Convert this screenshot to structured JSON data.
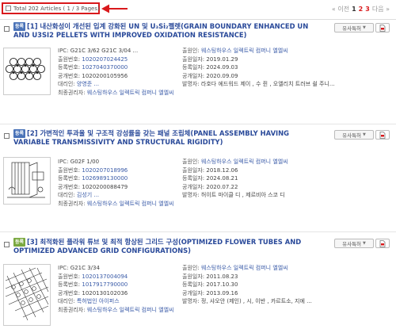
{
  "header": {
    "total_label": "Total 202 Articles ( 1 / 3 Pages)",
    "prev_label": "« 이전",
    "pages": [
      "1",
      "2",
      "3"
    ],
    "next_label": "다음 »"
  },
  "common": {
    "similar_label": "유사특허",
    "colors": {
      "accent_red": "#d9191c",
      "title_blue": "#2a4a9a",
      "badge_registered": "#4a73b8",
      "badge_published": "#7aa840"
    }
  },
  "results": [
    {
      "badge": "등록",
      "number": "[1]",
      "title": "내산화성이 개선된 입계 강화된 UN 및 U₃Si₂펠렛(GRAIN BOUNDARY ENHANCED UN AND U3SI2 PELLETS WITH IMPROVED OXIDATION RESISTANCE)",
      "ipc_label": "IPC:",
      "ipc": "G21C 3/62   G21C 3/04 ...",
      "applicant_label": "출원인:",
      "applicant": "웨스팅하우스 일렉트릭 컴퍼니 엘엘씨",
      "app_no_label": "출원번호:",
      "app_no": "1020207024425",
      "app_date_label": "출원일자:",
      "app_date": "2019.01.29",
      "reg_no_label": "등록번호:",
      "reg_no": "1027040370000",
      "reg_date_label": "등록일자:",
      "reg_date": "2024.09.03",
      "pub_no_label": "공개번호:",
      "pub_no": "1020200105956",
      "pub_date_label": "공개일자:",
      "pub_date": "2020.09.09",
      "agent_label": "대리인:",
      "agent": "양영준 ...",
      "inventor_label": "발명자:",
      "inventor": "라호다 에드워드 제이 , 수 쥔 , 오엘리치 트러브 쉴 주니...",
      "holder_label": "최종권리자:",
      "holder": "웨스팅하우스 일렉트릭 컴퍼니 엘엘씨"
    },
    {
      "badge": "등록",
      "number": "[2]",
      "title": "가변적인 투과율 및 구조적 강성률을 갖는 패널 조립체(PANEL ASSEMBLY HAVING VARIABLE TRANSMISSIVITY AND STRUCTURAL RIGIDITY)",
      "ipc_label": "IPC:",
      "ipc": "G02F 1/00",
      "applicant_label": "출원인:",
      "applicant": "웨스팅하우스 일렉트릭 컴퍼니 엘엘씨",
      "app_no_label": "출원번호:",
      "app_no": "1020207018996",
      "app_date_label": "출원일자:",
      "app_date": "2018.12.06",
      "reg_no_label": "등록번호:",
      "reg_no": "1026989130000",
      "reg_date_label": "등록일자:",
      "reg_date": "2024.08.21",
      "pub_no_label": "공개번호:",
      "pub_no": "1020200088479",
      "pub_date_label": "공개일자:",
      "pub_date": "2020.07.22",
      "agent_label": "대리인:",
      "agent": "김성기 ...",
      "inventor_label": "발명자:",
      "inventor": "허이트 마이클 디 , 제르비아 스코 디",
      "holder_label": "최종권리자:",
      "holder": "웨스팅하우스 일렉트릭 컴퍼니 엘엘씨"
    },
    {
      "badge": "등록",
      "number": "[3]",
      "title": "최적화된 플라워 튜브 및 최적 항상된 그리드 구성(OPTIMIZED FLOWER TUBES AND OPTIMIZED ADVANCED GRID CONFIGURATIONS)",
      "ipc_label": "IPC:",
      "ipc": "G21C 3/34",
      "applicant_label": "출원인:",
      "applicant": "웨스팅하우스 일렉트릭 컴퍼니 엘엘씨",
      "app_no_label": "출원번호:",
      "app_no": "1020137004094",
      "app_date_label": "출원일자:",
      "app_date": "2011.08.23",
      "reg_no_label": "등록번호:",
      "reg_no": "1017917790000",
      "reg_date_label": "등록일자:",
      "reg_date": "2017.10.30",
      "pub_no_label": "공개번호:",
      "pub_no": "1020130102036",
      "pub_date_label": "공개일자:",
      "pub_date": "2013.09.16",
      "agent_label": "대리인:",
      "agent": "특허법인 아이퍼스",
      "inventor_label": "발명자:",
      "inventor": "정, 샤오안 (제인) , 시, 이반 , 카르트소, 지에 ...",
      "holder_label": "최종권리자:",
      "holder": "웨스팅하우스 일렉트릭 컴퍼니 엘엘씨"
    }
  ]
}
